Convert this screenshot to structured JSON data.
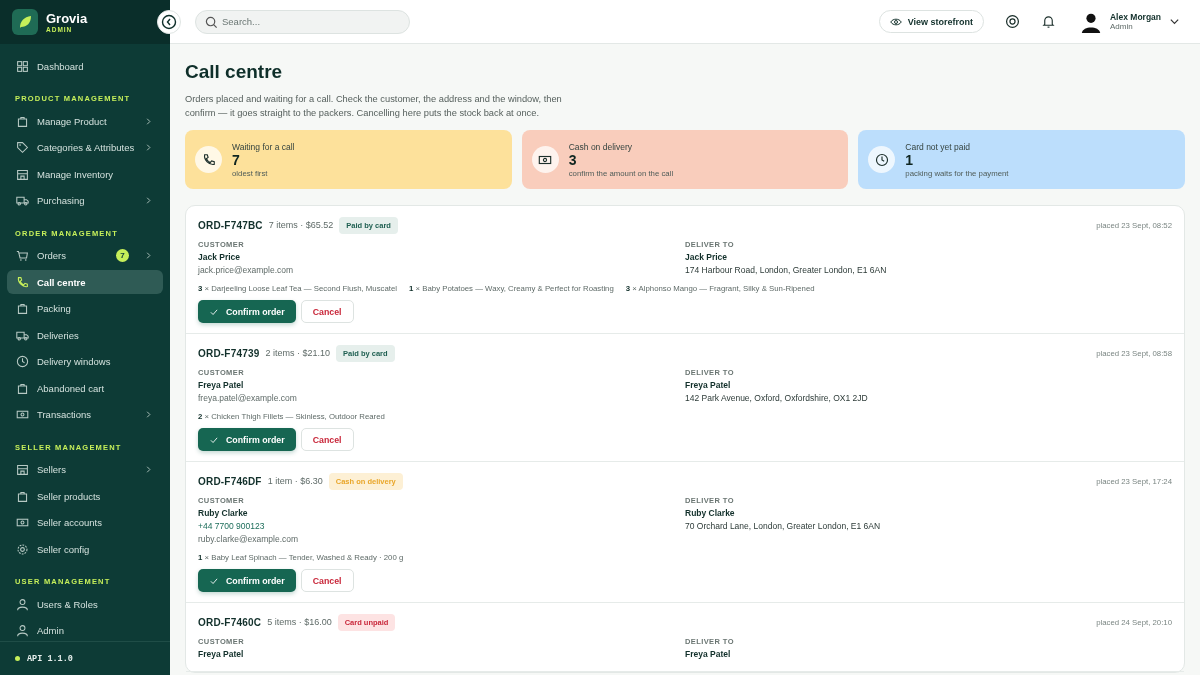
{
  "sidebar": {
    "brand": {
      "name": "Grovia",
      "sub": "ADMIN"
    },
    "groups": [
      {
        "items": [
          {
            "label": "Dashboard",
            "selected": false,
            "has_submenu": false
          }
        ]
      },
      {
        "heading": "PRODUCT MANAGEMENT",
        "items": [
          {
            "label": "Manage Product",
            "selected": false,
            "has_submenu": true
          },
          {
            "label": "Categories & Attributes",
            "selected": false,
            "has_submenu": true
          },
          {
            "label": "Manage Inventory",
            "selected": false,
            "has_submenu": false
          },
          {
            "label": "Purchasing",
            "selected": false,
            "has_submenu": true
          }
        ]
      },
      {
        "heading": "ORDER MANAGEMENT",
        "items": [
          {
            "label": "Orders",
            "selected": false,
            "has_submenu": true,
            "badge": "7"
          },
          {
            "label": "Call centre",
            "selected": true,
            "has_submenu": false
          },
          {
            "label": "Packing",
            "selected": false,
            "has_submenu": false
          },
          {
            "label": "Deliveries",
            "selected": false,
            "has_submenu": false
          },
          {
            "label": "Delivery windows",
            "selected": false,
            "has_submenu": false
          },
          {
            "label": "Abandoned cart",
            "selected": false,
            "has_submenu": false
          },
          {
            "label": "Transactions",
            "selected": false,
            "has_submenu": true
          }
        ]
      },
      {
        "heading": "SELLER MANAGEMENT",
        "items": [
          {
            "label": "Sellers",
            "selected": false,
            "has_submenu": true
          },
          {
            "label": "Seller products",
            "selected": false,
            "has_submenu": false
          },
          {
            "label": "Seller accounts",
            "selected": false,
            "has_submenu": false
          },
          {
            "label": "Seller config",
            "selected": false,
            "has_submenu": false
          }
        ]
      },
      {
        "heading": "USER MANAGEMENT",
        "items": [
          {
            "label": "Users & Roles",
            "selected": false,
            "has_submenu": false
          },
          {
            "label": "Admin",
            "selected": false,
            "has_submenu": false
          }
        ]
      }
    ],
    "footer": "API 1.1.0"
  },
  "topbar": {
    "search": {
      "placeholder": "Search..."
    },
    "storefront_button": "View storefront",
    "user": {
      "name": "Alex Morgan",
      "role": "Admin"
    }
  },
  "page": {
    "title": "Call centre",
    "description": "Orders placed and waiting for a call. Check the customer, the address and the window, then confirm — it goes straight to the packers. Cancelling here puts the stock back at once."
  },
  "stats": [
    {
      "kind": "waiting",
      "label": "Waiting for a call",
      "value": "7",
      "note": "oldest first"
    },
    {
      "kind": "cash",
      "label": "Cash on delivery",
      "value": "3",
      "note": "confirm the amount on the call"
    },
    {
      "kind": "card",
      "label": "Card not yet paid",
      "value": "1",
      "note": "packing waits for the payment"
    }
  ],
  "orders": [
    {
      "id": "ORD-F747BC",
      "summary": "7 items · $65.52",
      "payment": {
        "kind": "paid",
        "label": "Paid by card"
      },
      "placed": "placed 23 Sept, 08:52",
      "customer": {
        "heading": "CUSTOMER",
        "name": "Jack Price",
        "email": "jack.price@example.com"
      },
      "deliver": {
        "heading": "DELIVER TO",
        "name": "Jack Price",
        "address": "174 Harbour Road, London, Greater London, E1 6AN"
      },
      "lines": [
        "**3** × Darjeeling Loose Leaf Tea — Second Flush, Muscatel",
        "**1** × Baby Potatoes — Waxy, Creamy & Perfect for Roasting",
        "**3** × Alphonso Mango — Fragrant, Silky & Sun-Ripened"
      ],
      "confirm": "Confirm order",
      "cancel": "Cancel"
    },
    {
      "id": "ORD-F74739",
      "summary": "2 items · $21.10",
      "payment": {
        "kind": "paid",
        "label": "Paid by card"
      },
      "placed": "placed 23 Sept, 08:58",
      "customer": {
        "heading": "CUSTOMER",
        "name": "Freya Patel",
        "email": "freya.patel@example.com"
      },
      "deliver": {
        "heading": "DELIVER TO",
        "name": "Freya Patel",
        "address": "142 Park Avenue, Oxford, Oxfordshire, OX1 2JD"
      },
      "lines": [
        "**2** × Chicken Thigh Fillets — Skinless, Outdoor Reared"
      ],
      "confirm": "Confirm order",
      "cancel": "Cancel"
    },
    {
      "id": "ORD-F746DF",
      "summary": "1 item · $6.30",
      "payment": {
        "kind": "cod",
        "label": "Cash on delivery"
      },
      "placed": "placed 23 Sept, 17:24",
      "customer": {
        "heading": "CUSTOMER",
        "name": "Ruby Clarke",
        "phone": "+44 7700 900123",
        "email": "ruby.clarke@example.com"
      },
      "deliver": {
        "heading": "DELIVER TO",
        "name": "Ruby Clarke",
        "address": "70 Orchard Lane, London, Greater London, E1 6AN"
      },
      "lines": [
        "**1** × Baby Leaf Spinach — Tender, Washed & Ready · 200 g"
      ],
      "confirm": "Confirm order",
      "cancel": "Cancel"
    },
    {
      "id": "ORD-F7460C",
      "summary": "5 items · $16.00",
      "payment": {
        "kind": "unpaid",
        "label": "Card unpaid"
      },
      "placed": "placed 24 Sept, 20:10",
      "customer": {
        "heading": "CUSTOMER",
        "name": "Freya Patel"
      },
      "deliver": {
        "heading": "DELIVER TO",
        "name": "Freya Patel"
      }
    }
  ]
}
